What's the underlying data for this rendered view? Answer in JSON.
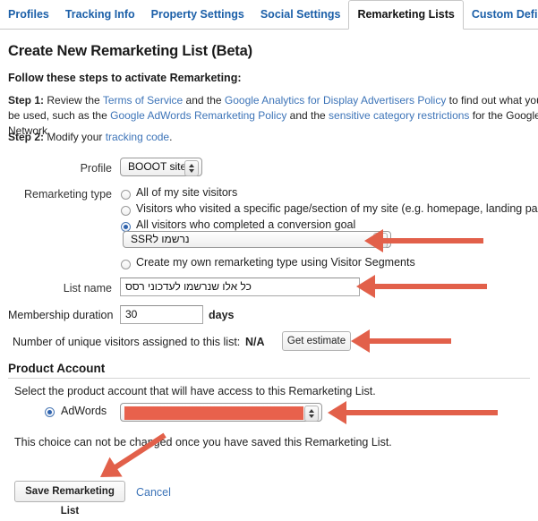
{
  "tabs": [
    {
      "label": "Profiles",
      "active": false
    },
    {
      "label": "Tracking Info",
      "active": false
    },
    {
      "label": "Property Settings",
      "active": false
    },
    {
      "label": "Social Settings",
      "active": false
    },
    {
      "label": "Remarketing Lists",
      "active": true
    },
    {
      "label": "Custom Definitions",
      "active": false
    }
  ],
  "page": {
    "title": "Create New Remarketing List (Beta)",
    "subtitle": "Follow these steps to activate Remarketing:"
  },
  "steps": {
    "step1_label": "Step 1:",
    "step1_a": " Review the ",
    "step1_link1": "Terms of Service",
    "step1_b": " and the ",
    "step1_link2": "Google Analytics for Display Advertisers Policy",
    "step1_c": " to find out what your data can be",
    "step1_d": "used, such as the ",
    "step1_link3": "Google AdWords Remarketing Policy",
    "step1_e": " and the ",
    "step1_link4": "sensitive category restrictions",
    "step1_f": " for the Google Display Network.",
    "step2_label": "Step 2:",
    "step2_a": " Modify your ",
    "step2_link": "tracking code",
    "step2_b": "."
  },
  "form": {
    "profile_label": "Profile",
    "profile_value": "BOOOT site",
    "remarketing_type_label": "Remarketing type",
    "options": [
      {
        "label": "All of my site visitors",
        "selected": false
      },
      {
        "label": "Visitors who visited a specific page/section of my site (e.g. homepage, landing page, etc.)",
        "selected": false
      },
      {
        "label": "All visitors who completed a conversion goal",
        "selected": true
      },
      {
        "label": "Create my own remarketing type using Visitor Segments",
        "selected": false
      }
    ],
    "goal_select_value": "נרשמו לRSS",
    "list_name_label": "List name",
    "list_name_value": "כל אלו שנרשמו לעדכוני רסס",
    "membership_label": "Membership duration",
    "membership_value": "30",
    "days_label": "days",
    "unique_visitors_label": "Number of unique visitors assigned to this list:",
    "unique_visitors_value": "N/A",
    "get_estimate_label": "Get estimate"
  },
  "product_account": {
    "heading": "Product Account",
    "description": "Select the product account that will have access to this Remarketing List.",
    "adwords_label": "AdWords",
    "adwords_selected": true,
    "adwords_value": "",
    "note": "This choice can not be changed once you have saved this Remarketing List."
  },
  "actions": {
    "save_label": "Save Remarketing List",
    "cancel_label": "Cancel"
  },
  "annotations": {
    "arrow_color": "#e2604a",
    "count": 5,
    "targets": [
      "goal-dropdown",
      "list-name-input",
      "get-estimate-button",
      "adwords-dropdown",
      "save-button"
    ]
  },
  "colors": {
    "link": "#3d74b8",
    "tab_link": "#1b5fa8",
    "redaction": "#e8614c",
    "text": "#222222"
  }
}
